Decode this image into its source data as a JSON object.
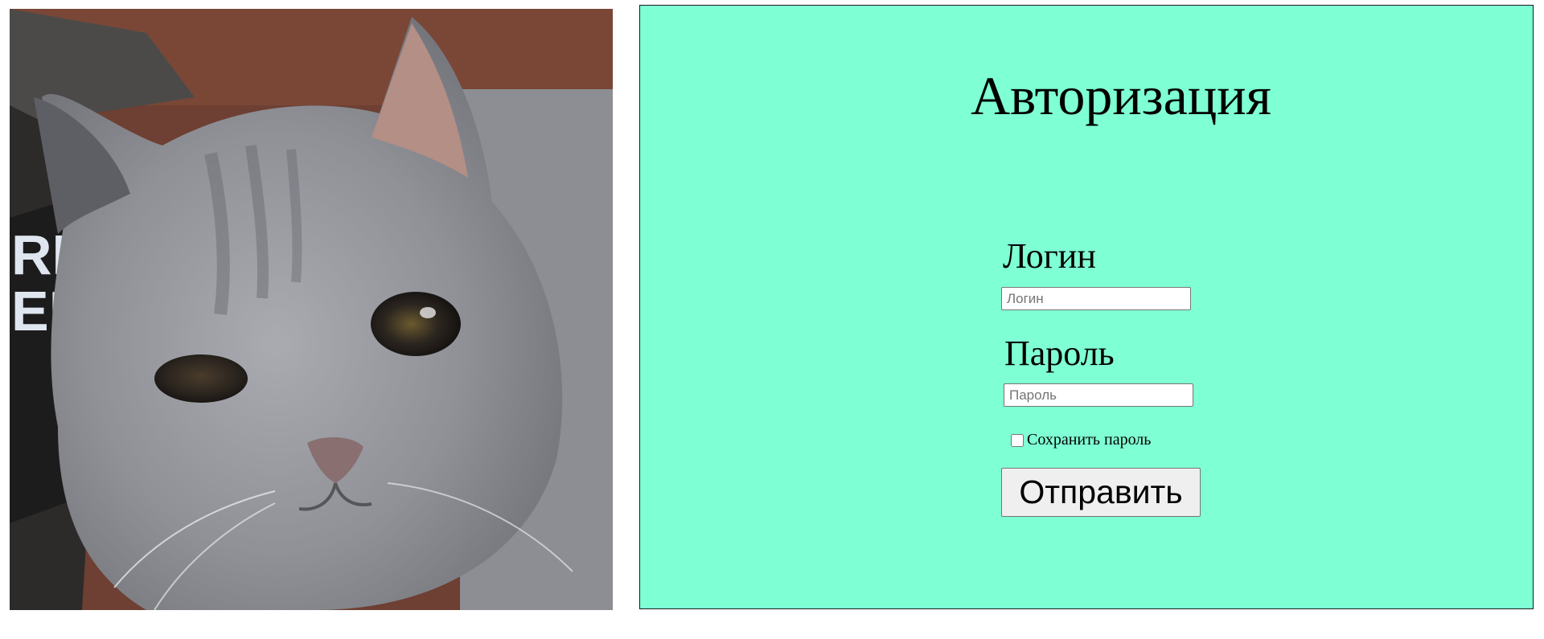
{
  "photo": {
    "subject": "grey british shorthair cat close-up"
  },
  "form": {
    "title": "Авторизация",
    "login_label": "Логин",
    "login_placeholder": "Логин",
    "login_value": "",
    "password_label": "Пароль",
    "password_placeholder": "Пароль",
    "password_value": "",
    "remember_label": "Сохранить пароль",
    "remember_checked": false,
    "submit_label": "Отправить"
  },
  "colors": {
    "panel_background": "#7fffd4",
    "panel_border": "#1a1a1a",
    "text": "#000000",
    "button_background": "#efefef"
  }
}
